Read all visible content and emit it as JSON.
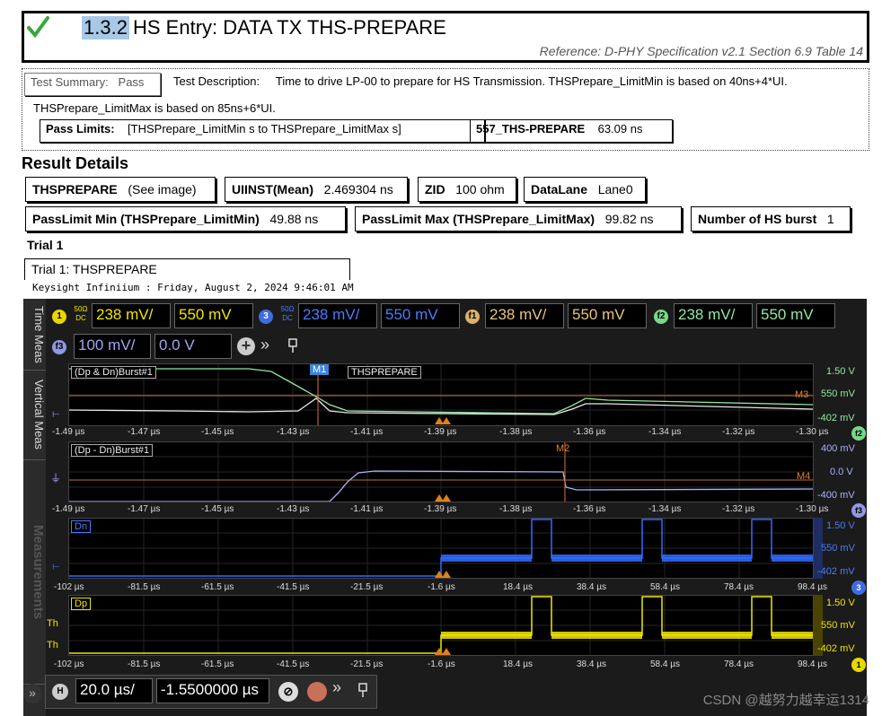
{
  "header": {
    "number": "1.3.2",
    "title": "HS Entry: DATA TX THS-PREPARE",
    "reference": "Reference: D-PHY Specification v2.1 Section 6.9 Table 14"
  },
  "summary": {
    "test_summary_label": "Test Summary:",
    "test_summary_value": "Pass",
    "desc_label": "Test Description:",
    "desc_line1": "Time to drive LP-00 to prepare for HS Transmission. THSPrepare_LimitMin is based on 40ns+4*UI.",
    "desc_line2": "THSPrepare_LimitMax is based on 85ns+6*UI.",
    "pass_limits_label": "Pass Limits:",
    "pass_limits_value": "[THSPrepare_LimitMin s to THSPrepare_LimitMax s]",
    "meas_label": "557_THS-PREPARE",
    "meas_value": "63.09 ns"
  },
  "results": {
    "heading": "Result Details",
    "params_row1": [
      {
        "k": "THSPREPARE",
        "v": "(See image)"
      },
      {
        "k": "UIINST(Mean)",
        "v": "2.469304 ns"
      },
      {
        "k": "ZID",
        "v": "100 ohm"
      },
      {
        "k": "DataLane",
        "v": "Lane0"
      }
    ],
    "params_row2": [
      {
        "k": "PassLimit Min (THSPrepare_LimitMin)",
        "v": "49.88 ns"
      },
      {
        "k": "PassLimit Max (THSPrepare_LimitMax)",
        "v": "99.82 ns"
      },
      {
        "k": "Number of HS burst",
        "v": "1"
      }
    ],
    "trial_heading": "Trial 1",
    "image_title": "Trial 1: THSPREPARE",
    "scope_caption": "Keysight Infiniium : Friday, August 2, 2024 9:46:01 AM"
  },
  "scope": {
    "side_tabs": [
      "Time Meas",
      "Vertical Meas",
      "Measurements"
    ],
    "channels": [
      {
        "btn": "1",
        "coupling": "50Ω DC",
        "scale": "238 mV/",
        "offset": "550 mV",
        "color": "#f2e600"
      },
      {
        "btn": "3",
        "coupling": "50Ω DC",
        "scale": "238 mV/",
        "offset": "550 mV",
        "color": "#4a7cff"
      },
      {
        "btn": "f1",
        "coupling": "",
        "scale": "238 mV/",
        "offset": "550 mV",
        "color": "#e8c67a"
      },
      {
        "btn": "f2",
        "coupling": "",
        "scale": "238 mV/",
        "offset": "550 mV",
        "color": "#8fe8a0"
      }
    ],
    "f3": {
      "btn": "f3",
      "scale": "100 mV/",
      "offset": "0.0 V",
      "color": "#9fa6f0"
    },
    "panels": [
      {
        "label": "(Dp & Dn)Burst#1",
        "marker1": "M1",
        "marker_label": "THSPREPARE",
        "marker3": "M3",
        "levels": [
          "1.50 V",
          "550 mV",
          "-402 mV"
        ],
        "fn": "f2",
        "xticks": [
          "-1.49 µs",
          "-1.47 µs",
          "-1.45 µs",
          "-1.43 µs",
          "-1.41 µs",
          "-1.39 µs",
          "-1.38 µs",
          "-1.36 µs",
          "-1.34 µs",
          "-1.32 µs",
          "-1.30 µs"
        ]
      },
      {
        "label": "(Dp - Dn)Burst#1",
        "marker2": "M2",
        "marker4": "M4",
        "levels": [
          "400 mV",
          "0.0 V",
          "-400 mV"
        ],
        "fn": "f3",
        "xticks": [
          "-1.49 µs",
          "-1.47 µs",
          "-1.45 µs",
          "-1.43 µs",
          "-1.41 µs",
          "-1.39 µs",
          "-1.38 µs",
          "-1.36 µs",
          "-1.34 µs",
          "-1.32 µs",
          "-1.30 µs"
        ]
      },
      {
        "label": "Dn",
        "levels": [
          "1.50 V",
          "550 mV",
          "-402 mV"
        ],
        "fn": "3",
        "xticks": [
          "-102 µs",
          "-81.5 µs",
          "-61.5 µs",
          "-41.5 µs",
          "-21.5 µs",
          "-1.6 µs",
          "18.4 µs",
          "38.4 µs",
          "58.4 µs",
          "78.4 µs",
          "98.4 µs"
        ]
      },
      {
        "label": "Dp",
        "levels": [
          "1.50 V",
          "550 mV",
          "-402 mV"
        ],
        "fn": "1",
        "th1": "Th",
        "th2": "Th",
        "xticks": [
          "-102 µs",
          "-81.5 µs",
          "-61.5 µs",
          "-41.5 µs",
          "-21.5 µs",
          "-1.6 µs",
          "18.4 µs",
          "38.4 µs",
          "58.4 µs",
          "78.4 µs",
          "98.4 µs"
        ]
      }
    ],
    "timebase": {
      "h_btn": "H",
      "scale": "20.0 µs/",
      "position": "-1.5500000 µs"
    }
  },
  "watermark": "CSDN @越努力越幸运1314"
}
